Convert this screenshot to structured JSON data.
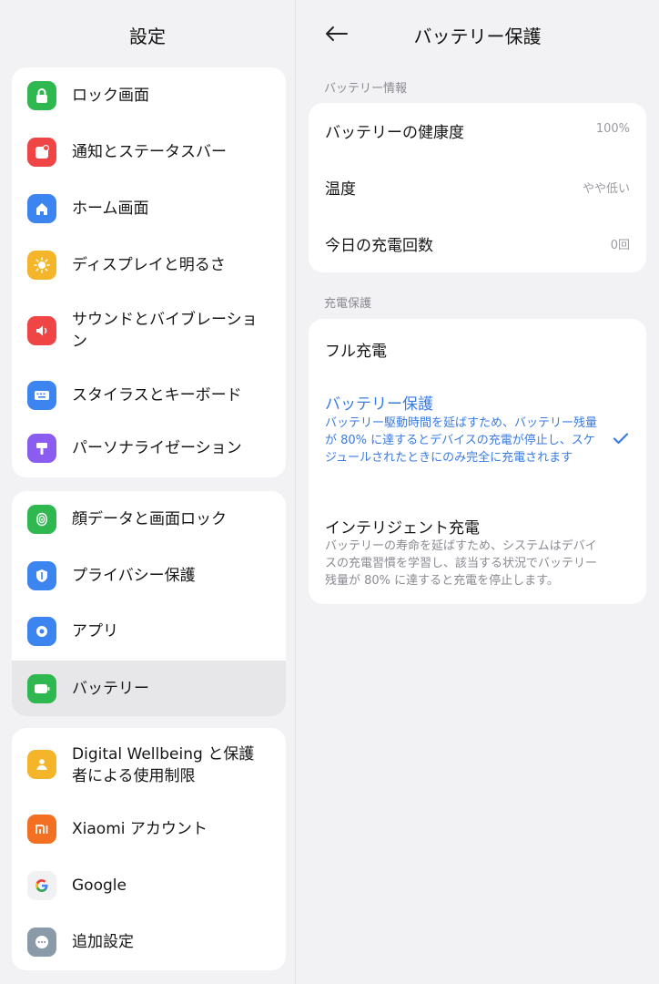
{
  "left": {
    "title": "設定",
    "groups": [
      {
        "items": [
          {
            "label": "ロック画面",
            "icon": "lock-icon",
            "color": "#2fb84f"
          },
          {
            "label": "通知とステータスバー",
            "icon": "notification-icon",
            "color": "#f04545"
          },
          {
            "label": "ホーム画面",
            "icon": "home-icon",
            "color": "#3c84f0"
          },
          {
            "label": "ディスプレイと明るさ",
            "icon": "sun-icon",
            "color": "#f5b52a"
          },
          {
            "label": "サウンドとバイブレーション",
            "icon": "speaker-icon",
            "color": "#f04545"
          },
          {
            "label": "スタイラスとキーボード",
            "icon": "keyboard-icon",
            "color": "#3c84f0"
          },
          {
            "label": "パーソナライゼーション",
            "icon": "brush-icon",
            "color": "#8a5cf0"
          }
        ]
      },
      {
        "items": [
          {
            "label": "顔データと画面ロック",
            "icon": "fingerprint-icon",
            "color": "#2fb84f"
          },
          {
            "label": "プライバシー保護",
            "icon": "shield-icon",
            "color": "#3c84f0"
          },
          {
            "label": "アプリ",
            "icon": "gear-icon",
            "color": "#3c84f0"
          },
          {
            "label": "バッテリー",
            "icon": "battery-icon",
            "color": "#2fb84f"
          }
        ]
      },
      {
        "items": [
          {
            "label": "Digital Wellbeing と保護者による使用制限",
            "icon": "wellbeing-icon",
            "color": "#f5b52a"
          },
          {
            "label": "Xiaomi アカウント",
            "icon": "xiaomi-icon",
            "color": "#f36f21"
          },
          {
            "label": "Google",
            "icon": "google-icon",
            "color": "#ffffff"
          },
          {
            "label": "追加設定",
            "icon": "more-icon",
            "color": "#8a9aa8"
          }
        ]
      }
    ]
  },
  "right": {
    "title": "バッテリー保護",
    "sections": {
      "info_label": "バッテリー情報",
      "info_rows": [
        {
          "label": "バッテリーの健康度",
          "value": "100%"
        },
        {
          "label": "温度",
          "value": "やや低い"
        },
        {
          "label": "今日の充電回数",
          "value": "0回"
        }
      ],
      "protect_label": "充電保護",
      "options": [
        {
          "title": "フル充電",
          "desc": ""
        },
        {
          "title": "バッテリー保護",
          "desc": "バッテリー駆動時間を延ばすため、バッテリー残量が 80% に達するとデバイスの充電が停止し、スケジュールされたときにのみ完全に充電されます"
        },
        {
          "title": "インテリジェント充電",
          "desc": "バッテリーの寿命を延ばすため、システムはデバイスの充電習慣を学習し、該当する状況でバッテリー残量が 80% に達すると充電を停止します。"
        }
      ]
    },
    "accent": "#3a7be0"
  }
}
